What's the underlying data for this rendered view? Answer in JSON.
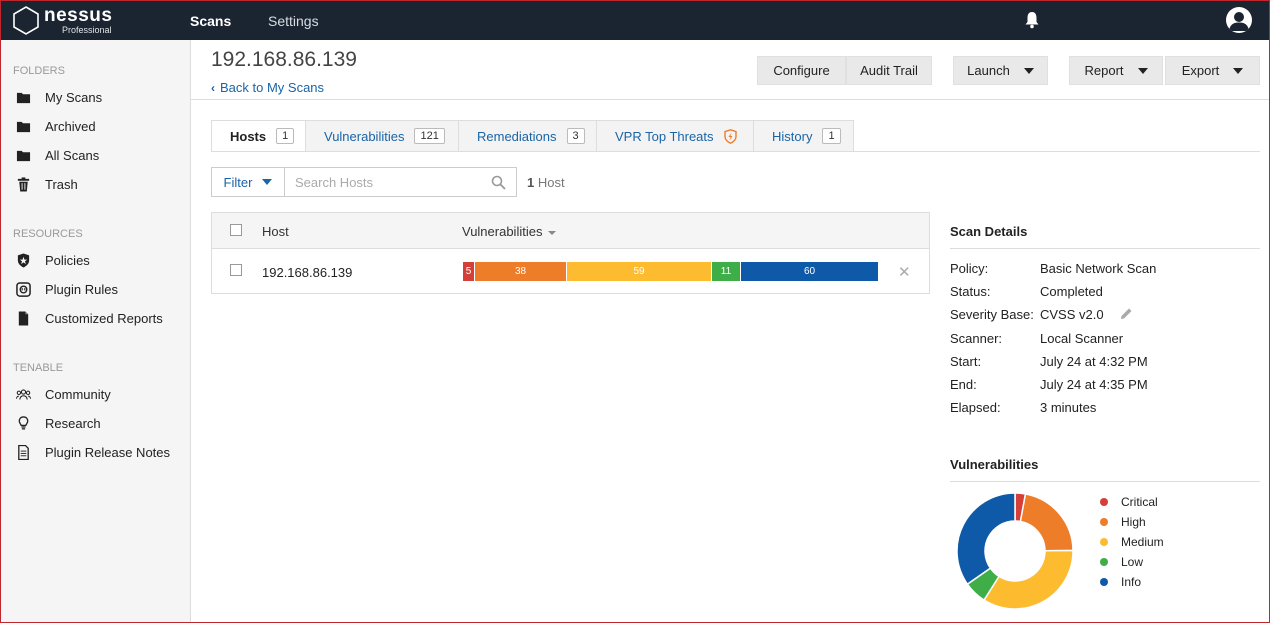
{
  "topbar": {
    "brand": "nessus",
    "brand_sub": "Professional",
    "nav": [
      {
        "label": "Scans",
        "active": true
      },
      {
        "label": "Settings",
        "active": false
      }
    ]
  },
  "sidebar": {
    "folders_label": "FOLDERS",
    "folders": [
      {
        "label": "My Scans",
        "icon": "folder-icon"
      },
      {
        "label": "Archived",
        "icon": "folder-icon"
      },
      {
        "label": "All Scans",
        "icon": "folder-icon"
      },
      {
        "label": "Trash",
        "icon": "trash-icon"
      }
    ],
    "resources_label": "RESOURCES",
    "resources": [
      {
        "label": "Policies",
        "icon": "shield-star-icon"
      },
      {
        "label": "Plugin Rules",
        "icon": "plug-icon"
      },
      {
        "label": "Customized Reports",
        "icon": "document-icon"
      }
    ],
    "tenable_label": "TENABLE",
    "tenable": [
      {
        "label": "Community",
        "icon": "people-icon"
      },
      {
        "label": "Research",
        "icon": "lightbulb-icon"
      },
      {
        "label": "Plugin Release Notes",
        "icon": "notes-icon"
      }
    ]
  },
  "header": {
    "title": "192.168.86.139",
    "back_link": "Back to My Scans",
    "buttons": {
      "configure": "Configure",
      "audit_trail": "Audit Trail",
      "launch": "Launch",
      "report": "Report",
      "export": "Export"
    }
  },
  "tabs": [
    {
      "label": "Hosts",
      "count": "1",
      "active": true
    },
    {
      "label": "Vulnerabilities",
      "count": "121"
    },
    {
      "label": "Remediations",
      "count": "3"
    },
    {
      "label": "VPR Top Threats",
      "icon": "vpr-shield-icon"
    },
    {
      "label": "History",
      "count": "1"
    }
  ],
  "filter": {
    "button": "Filter",
    "search_placeholder": "Search Hosts",
    "host_count_num": "1",
    "host_count_label": "Host"
  },
  "table": {
    "headers": {
      "host": "Host",
      "vulnerabilities": "Vulnerabilities"
    },
    "rows": [
      {
        "host": "192.168.86.139",
        "severity": {
          "critical": "5",
          "high": "38",
          "medium": "59",
          "low": "11",
          "info": "60"
        }
      }
    ]
  },
  "scan_details": {
    "title": "Scan Details",
    "fields": [
      {
        "label": "Policy:",
        "value": "Basic Network Scan"
      },
      {
        "label": "Status:",
        "value": "Completed"
      },
      {
        "label": "Severity Base:",
        "value": "CVSS v2.0"
      },
      {
        "label": "Scanner:",
        "value": "Local Scanner"
      },
      {
        "label": "Start:",
        "value": "July 24 at 4:32 PM"
      },
      {
        "label": "End:",
        "value": "July 24 at 4:35 PM"
      },
      {
        "label": "Elapsed:",
        "value": "3 minutes"
      }
    ]
  },
  "vulnerabilities_panel": {
    "title": "Vulnerabilities",
    "legend": [
      "Critical",
      "High",
      "Medium",
      "Low",
      "Info"
    ]
  },
  "colors": {
    "critical": "#d43f3a",
    "high": "#ee7d2a",
    "medium": "#fdbb2f",
    "low": "#3fae49",
    "info": "#0f5aa8",
    "link": "#1a64a7",
    "topbar": "#1b2431"
  },
  "chart_data": {
    "type": "pie",
    "categories": [
      "Critical",
      "High",
      "Medium",
      "Low",
      "Info"
    ],
    "values": [
      5,
      38,
      59,
      11,
      60
    ],
    "title": "Vulnerabilities"
  }
}
